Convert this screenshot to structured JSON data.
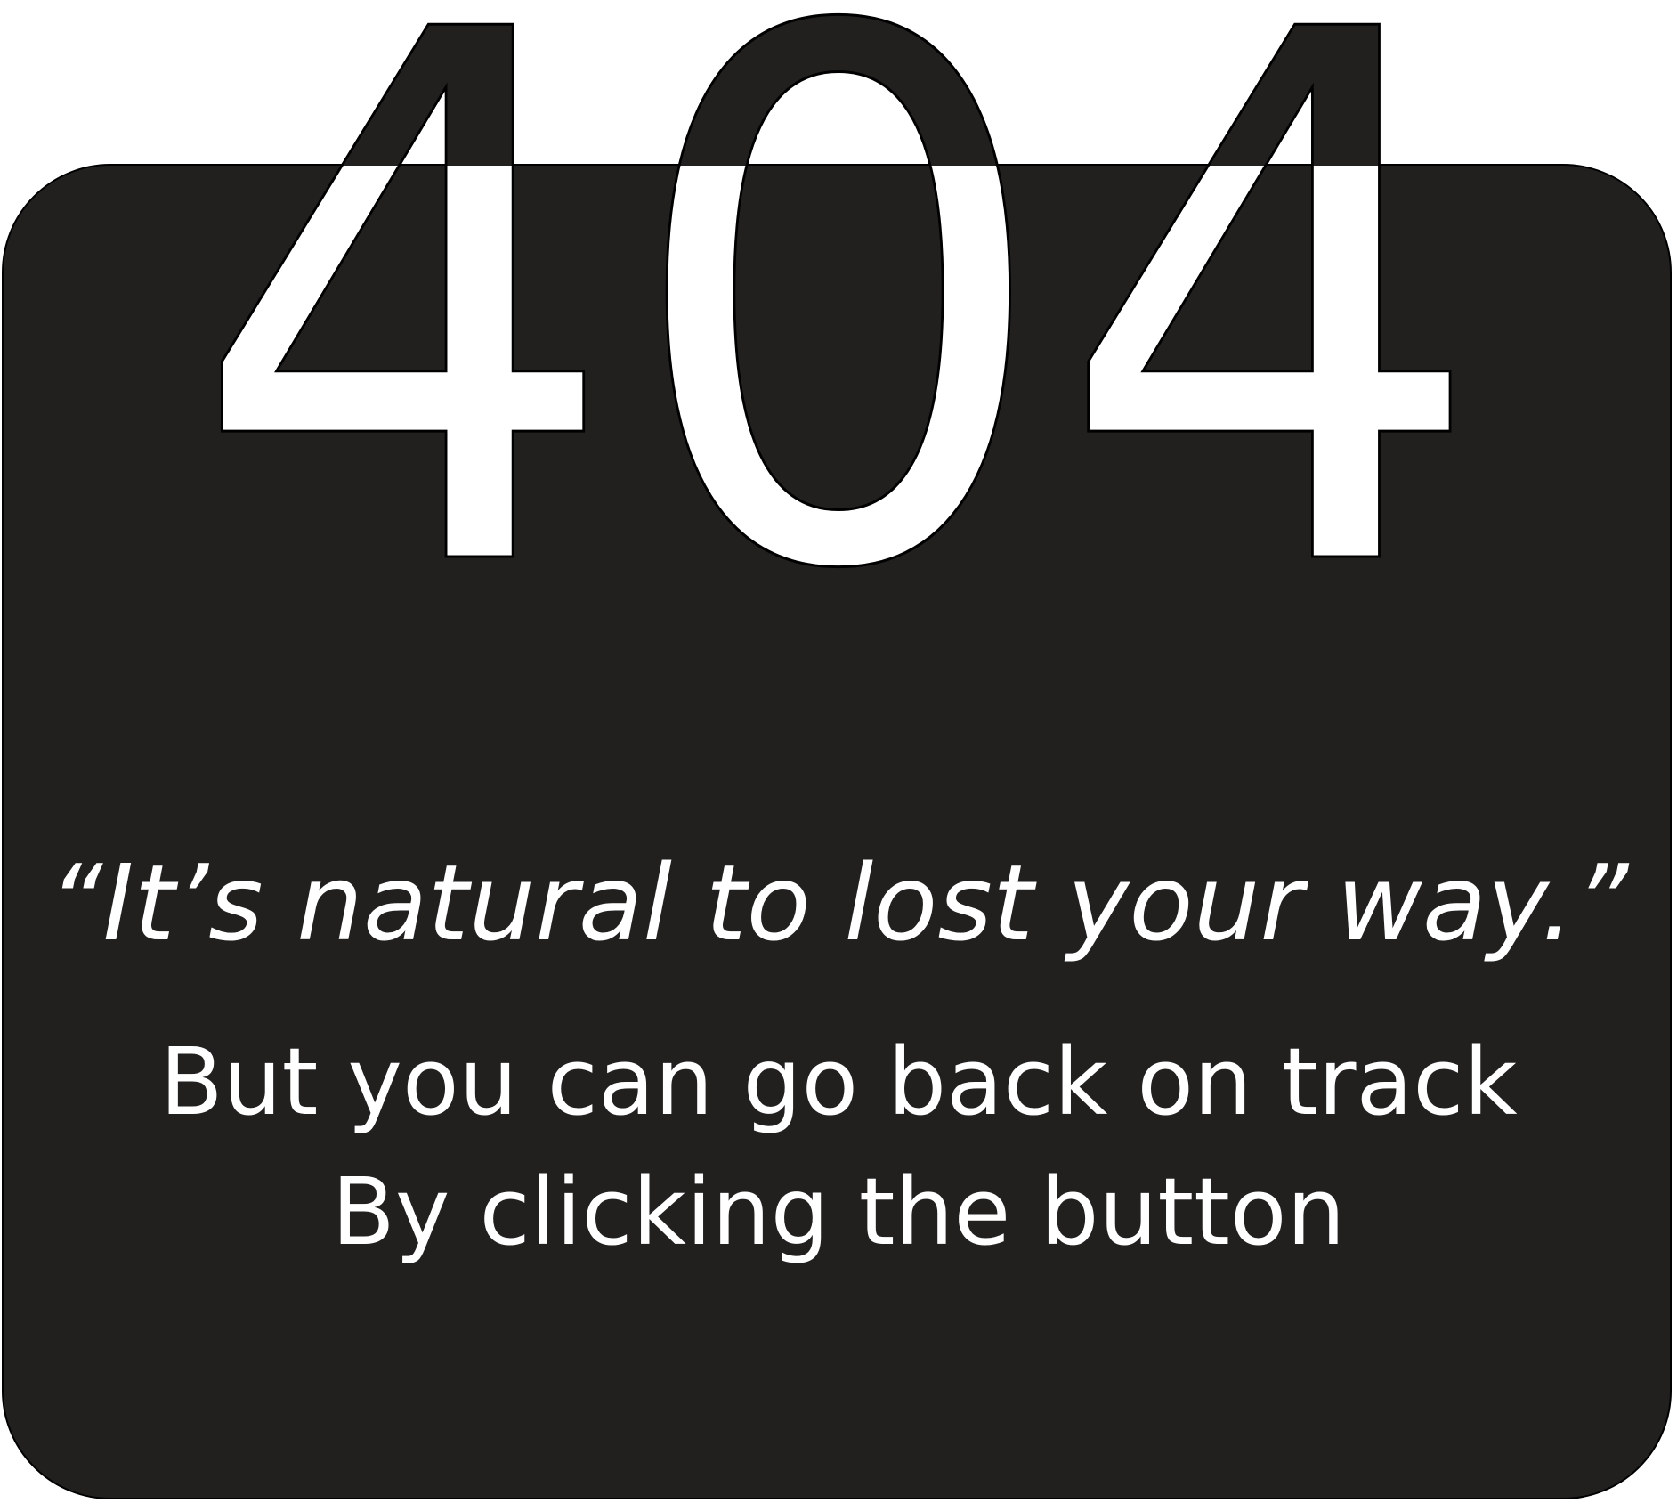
{
  "error_page": {
    "code": "404",
    "quote": "“It’s natural to lost your way.”",
    "message_line_1": "But you can go back on track",
    "message_line_2": "By clicking the button"
  },
  "colors": {
    "card_background": "#221f1f",
    "page_background": "#ffffff",
    "text": "#ffffff",
    "outline": "#000000"
  }
}
